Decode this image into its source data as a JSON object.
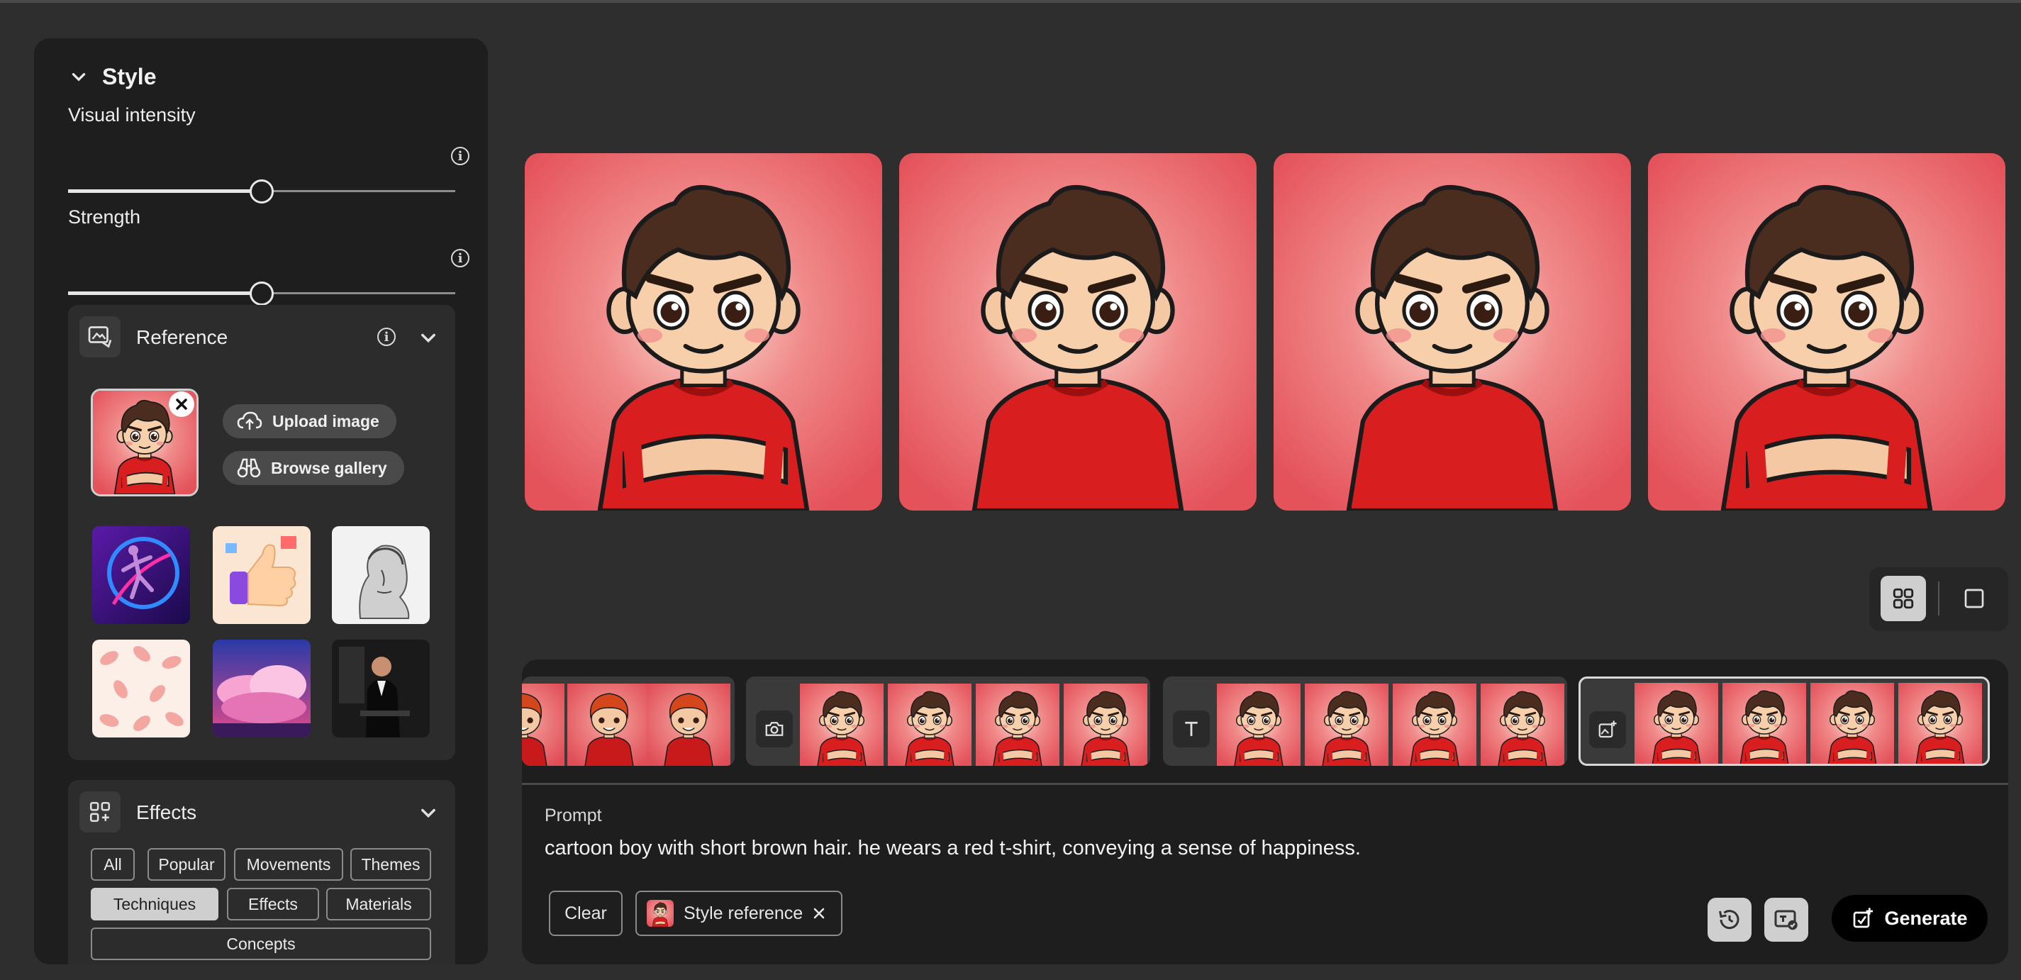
{
  "style_panel": {
    "title": "Style",
    "visual_intensity": {
      "label": "Visual intensity",
      "value": 0.5
    },
    "strength": {
      "label": "Strength",
      "value": 0.5
    }
  },
  "reference": {
    "title": "Reference",
    "upload_label": "Upload image",
    "browse_label": "Browse gallery"
  },
  "effects": {
    "title": "Effects",
    "chips": [
      {
        "label": "All",
        "selected": false
      },
      {
        "label": "Popular",
        "selected": false
      },
      {
        "label": "Movements",
        "selected": false
      },
      {
        "label": "Themes",
        "selected": false
      },
      {
        "label": "Techniques",
        "selected": true
      },
      {
        "label": "Effects",
        "selected": false
      },
      {
        "label": "Materials",
        "selected": false
      },
      {
        "label": "Concepts",
        "selected": false
      }
    ]
  },
  "prompt": {
    "label": "Prompt",
    "text": "cartoon boy with short brown hair. he wears a red t-shirt, conveying a sense of happiness.",
    "clear_label": "Clear",
    "style_ref_label": "Style reference",
    "generate_label": "Generate"
  },
  "colors": {
    "panel_bg": "#1e1e1e",
    "page_bg": "#2e2e2e",
    "image_bg": "#e95a5f",
    "shirt_red": "#d81e1e",
    "hair_brown": "#4a2d1e"
  }
}
